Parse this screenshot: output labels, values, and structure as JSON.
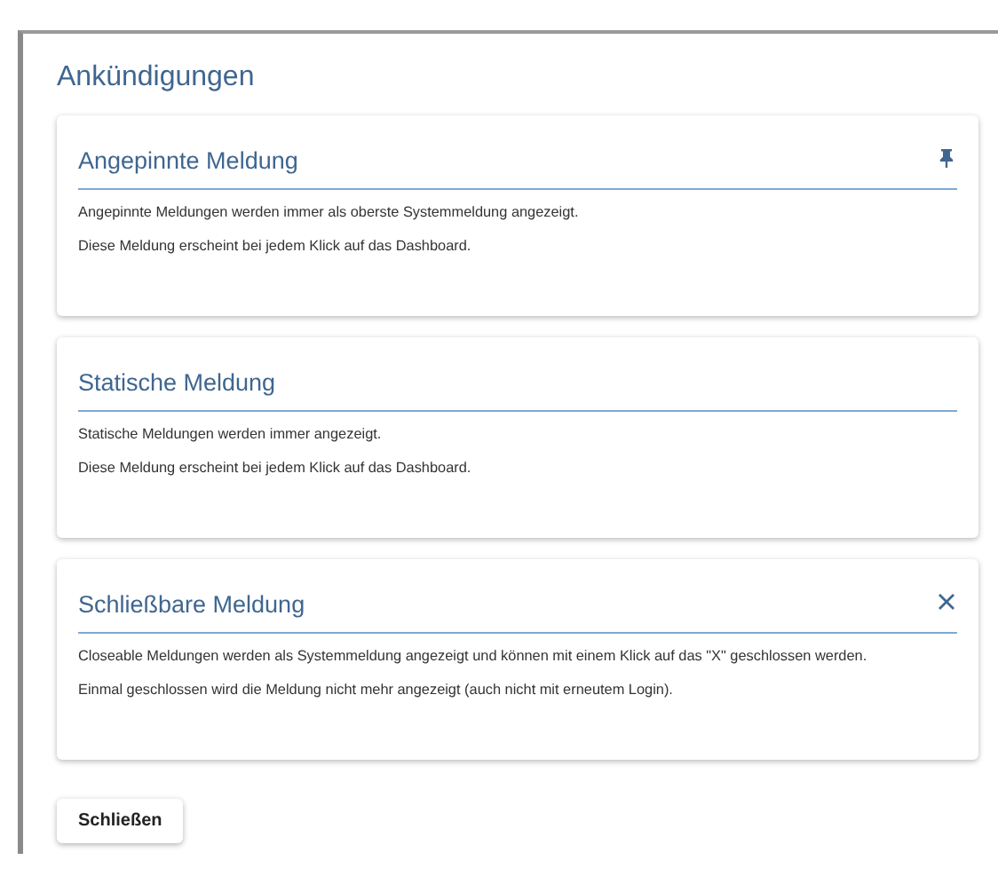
{
  "dialog": {
    "title": "Ankündigungen",
    "cards": [
      {
        "kind": "pinned",
        "title": "Angepinnte Meldung",
        "lines": [
          "Angepinnte Meldungen werden immer als oberste Systemmeldung angezeigt.",
          "Diese Meldung erscheint bei jedem Klick auf das Dashboard."
        ]
      },
      {
        "kind": "static",
        "title": "Statische Meldung",
        "lines": [
          "Statische Meldungen werden immer angezeigt.",
          "Diese Meldung erscheint bei jedem Klick auf das Dashboard."
        ]
      },
      {
        "kind": "closeable",
        "title": "Schließbare Meldung",
        "lines": [
          "Closeable Meldungen werden als Systemmeldung angezeigt und können mit einem Klick auf das \"X\" geschlossen werden.",
          "Einmal geschlossen wird die Meldung nicht mehr angezeigt (auch nicht mit erneutem Login)."
        ]
      }
    ],
    "button": "Schließen"
  }
}
